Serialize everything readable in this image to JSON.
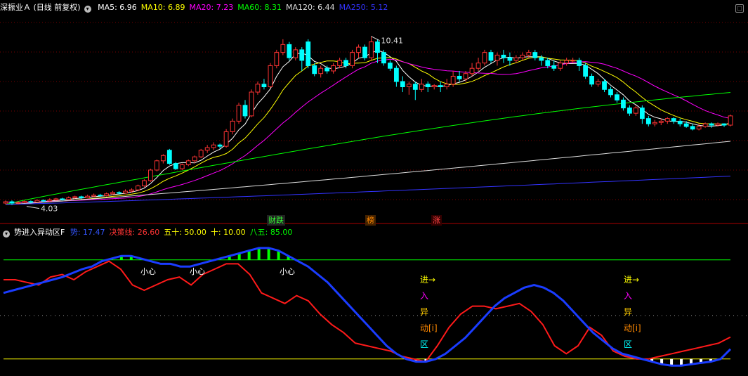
{
  "main": {
    "title": "深振业Ａ (日线 前复权)",
    "collapse_icon": "chevron-down-icon",
    "ma": [
      {
        "label": "MA5: 6.96",
        "color": "#ffffff"
      },
      {
        "label": "MA10: 6.89",
        "color": "#ffff00"
      },
      {
        "label": "MA20: 7.23",
        "color": "#ff00ff"
      },
      {
        "label": "MA60: 8.31",
        "color": "#00ff00"
      },
      {
        "label": "MA120: 6.44",
        "color": "#dddddd"
      },
      {
        "label": "MA250: 5.12",
        "color": "#3333ff"
      }
    ],
    "high_label": "10.41",
    "low_label": "4.03",
    "events": [
      {
        "label": "财跌",
        "color": "#33ff33",
        "bg": "#222222"
      },
      {
        "label": "榜",
        "color": "#ff8800",
        "bg": "#442200"
      },
      {
        "label": "涨",
        "color": "#ff4444",
        "bg": "#330000"
      }
    ],
    "up_color": "#ff3333",
    "down_color": "#00ffff",
    "expand_icon": "maximize-icon"
  },
  "indicator": {
    "title": "势进入异动区F",
    "params": [
      {
        "label": "势: 17.47",
        "color": "#3355ff"
      },
      {
        "label": "决策线: 26.60",
        "color": "#ff3333"
      },
      {
        "label": "五十: 50.00",
        "color": "#ffff00"
      },
      {
        "label": "十: 10.00",
        "color": "#ffff00"
      },
      {
        "label": "八五: 85.00",
        "color": "#00ff00"
      }
    ],
    "xiaoxin": "小心",
    "signal": {
      "jin": "进→",
      "ru": "入",
      "yi": "异",
      "dong": "动[i]",
      "qu": "区"
    },
    "line_85_color": "#00ff00",
    "line_10_color": "#ffff00",
    "bar_color_high": "#00ff00",
    "bar_color_low": "#ffffff",
    "shi_color": "#1a3cff",
    "jue_color": "#ff1a1a"
  },
  "chart_data": [
    {
      "type": "candlestick",
      "title": "深振业Ａ (日线 前复权)",
      "period": "日线",
      "adjust": "前复权",
      "series_values": {
        "MA5": 6.96,
        "MA10": 6.89,
        "MA20": 7.23,
        "MA60": 8.31,
        "MA120": 6.44,
        "MA250": 5.12
      },
      "annotations": [
        {
          "label": "10.41",
          "type": "high"
        },
        {
          "label": "4.03",
          "type": "low"
        }
      ],
      "ylim": [
        3.7,
        11.2
      ],
      "grid": true,
      "candles": [
        [
          4.1,
          4.15,
          4.05,
          4.2
        ],
        [
          4.15,
          4.1,
          4.03,
          4.2
        ],
        [
          4.1,
          4.12,
          4.05,
          4.18
        ],
        [
          4.12,
          4.16,
          4.1,
          4.2
        ],
        [
          4.16,
          4.14,
          4.1,
          4.2
        ],
        [
          4.14,
          4.2,
          4.12,
          4.25
        ],
        [
          4.2,
          4.18,
          4.12,
          4.24
        ],
        [
          4.18,
          4.22,
          4.15,
          4.28
        ],
        [
          4.22,
          4.26,
          4.2,
          4.3
        ],
        [
          4.26,
          4.24,
          4.2,
          4.3
        ],
        [
          4.24,
          4.3,
          4.22,
          4.35
        ],
        [
          4.3,
          4.34,
          4.26,
          4.38
        ],
        [
          4.34,
          4.3,
          4.25,
          4.38
        ],
        [
          4.3,
          4.36,
          4.28,
          4.42
        ],
        [
          4.36,
          4.4,
          4.32,
          4.46
        ],
        [
          4.4,
          4.38,
          4.33,
          4.45
        ],
        [
          4.38,
          4.45,
          4.35,
          4.5
        ],
        [
          4.45,
          4.5,
          4.4,
          4.56
        ],
        [
          4.5,
          4.48,
          4.42,
          4.55
        ],
        [
          4.48,
          4.55,
          4.45,
          4.62
        ],
        [
          4.55,
          4.6,
          4.5,
          4.66
        ],
        [
          4.6,
          4.75,
          4.56,
          4.8
        ],
        [
          4.75,
          4.95,
          4.7,
          5.0
        ],
        [
          4.95,
          5.35,
          4.9,
          5.4
        ],
        [
          5.35,
          5.7,
          5.3,
          5.75
        ],
        [
          5.7,
          5.9,
          5.6,
          5.95
        ],
        [
          6.1,
          5.6,
          5.55,
          6.15
        ],
        [
          5.6,
          5.4,
          5.35,
          5.65
        ],
        [
          5.4,
          5.55,
          5.35,
          5.6
        ],
        [
          5.55,
          5.7,
          5.5,
          5.75
        ],
        [
          5.7,
          5.85,
          5.6,
          5.9
        ],
        [
          5.85,
          6.1,
          5.8,
          6.15
        ],
        [
          6.1,
          6.2,
          6.0,
          6.3
        ],
        [
          6.2,
          6.3,
          6.1,
          6.4
        ],
        [
          6.3,
          6.25,
          6.15,
          6.35
        ],
        [
          6.25,
          6.8,
          6.2,
          6.9
        ],
        [
          6.8,
          7.2,
          6.7,
          7.3
        ],
        [
          7.2,
          7.8,
          7.1,
          7.9
        ],
        [
          7.8,
          7.4,
          7.3,
          8.0
        ],
        [
          7.4,
          8.3,
          7.35,
          8.4
        ],
        [
          8.3,
          8.6,
          8.2,
          8.7
        ],
        [
          8.6,
          8.5,
          8.4,
          8.8
        ],
        [
          8.5,
          9.3,
          8.45,
          9.4
        ],
        [
          9.3,
          9.8,
          9.2,
          9.9
        ],
        [
          9.8,
          10.1,
          9.7,
          10.3
        ],
        [
          10.1,
          9.6,
          9.5,
          10.2
        ],
        [
          9.6,
          9.9,
          9.5,
          10.0
        ],
        [
          9.9,
          9.5,
          9.1,
          10.0
        ],
        [
          10.2,
          9.3,
          9.2,
          10.3
        ],
        [
          9.3,
          9.0,
          8.9,
          9.4
        ],
        [
          9.0,
          9.2,
          8.85,
          9.3
        ],
        [
          9.2,
          9.1,
          9.0,
          9.3
        ],
        [
          9.1,
          9.3,
          9.0,
          9.4
        ],
        [
          9.3,
          9.5,
          9.2,
          9.6
        ],
        [
          9.5,
          9.3,
          9.2,
          9.6
        ],
        [
          9.3,
          9.8,
          9.2,
          9.9
        ],
        [
          9.8,
          10.0,
          9.6,
          10.1
        ],
        [
          10.0,
          9.6,
          9.5,
          10.1
        ],
        [
          9.6,
          10.2,
          9.5,
          10.41
        ],
        [
          10.2,
          9.8,
          9.4,
          10.3
        ],
        [
          9.8,
          9.4,
          9.3,
          9.9
        ],
        [
          9.4,
          9.2,
          9.1,
          9.5
        ],
        [
          9.2,
          8.7,
          8.5,
          9.3
        ],
        [
          8.7,
          8.5,
          8.3,
          8.9
        ],
        [
          8.5,
          8.6,
          8.2,
          8.7
        ],
        [
          8.6,
          8.4,
          8.0,
          8.7
        ],
        [
          8.4,
          8.6,
          8.3,
          8.8
        ],
        [
          8.6,
          8.5,
          8.3,
          8.7
        ],
        [
          8.5,
          8.55,
          8.4,
          8.6
        ],
        [
          8.55,
          8.5,
          8.3,
          8.7
        ],
        [
          8.5,
          8.6,
          8.4,
          8.8
        ],
        [
          8.6,
          8.9,
          8.5,
          9.1
        ],
        [
          8.9,
          8.8,
          8.7,
          9.1
        ],
        [
          8.8,
          9.0,
          8.7,
          9.1
        ],
        [
          9.0,
          9.2,
          8.9,
          9.4
        ],
        [
          9.2,
          9.4,
          9.1,
          9.6
        ],
        [
          9.4,
          9.8,
          9.3,
          9.9
        ],
        [
          9.8,
          9.5,
          9.4,
          9.9
        ],
        [
          9.5,
          9.7,
          9.3,
          9.8
        ],
        [
          9.7,
          9.6,
          9.4,
          9.9
        ],
        [
          9.6,
          9.5,
          9.3,
          9.8
        ],
        [
          9.5,
          9.6,
          9.4,
          9.7
        ],
        [
          9.6,
          9.7,
          9.5,
          9.8
        ],
        [
          9.7,
          9.8,
          9.6,
          9.9
        ],
        [
          9.8,
          9.6,
          9.5,
          9.9
        ],
        [
          9.6,
          9.5,
          9.3,
          9.7
        ],
        [
          9.5,
          9.3,
          9.2,
          9.6
        ],
        [
          9.3,
          9.2,
          9.1,
          9.5
        ],
        [
          9.2,
          9.4,
          9.1,
          9.5
        ],
        [
          9.4,
          9.5,
          9.3,
          9.6
        ],
        [
          9.5,
          9.5,
          9.4,
          9.6
        ],
        [
          9.5,
          9.3,
          9.1,
          9.6
        ],
        [
          9.3,
          8.9,
          8.8,
          9.4
        ],
        [
          8.9,
          8.6,
          8.5,
          9.0
        ],
        [
          8.6,
          8.7,
          8.5,
          8.8
        ],
        [
          8.7,
          8.4,
          8.3,
          8.8
        ],
        [
          8.4,
          8.2,
          8.1,
          8.5
        ],
        [
          8.2,
          8.0,
          7.9,
          8.3
        ],
        [
          8.0,
          7.7,
          7.6,
          8.1
        ],
        [
          7.7,
          7.5,
          7.4,
          7.8
        ],
        [
          7.5,
          7.7,
          7.4,
          7.8
        ],
        [
          7.7,
          7.3,
          7.1,
          7.8
        ],
        [
          7.3,
          7.1,
          7.0,
          7.4
        ],
        [
          7.1,
          7.15,
          7.0,
          7.25
        ],
        [
          7.15,
          7.2,
          7.05,
          7.3
        ],
        [
          7.2,
          7.3,
          7.1,
          7.35
        ],
        [
          7.3,
          7.2,
          7.1,
          7.35
        ],
        [
          7.2,
          7.1,
          7.0,
          7.3
        ],
        [
          7.1,
          7.0,
          6.95,
          7.2
        ],
        [
          7.0,
          6.9,
          6.85,
          7.1
        ],
        [
          6.9,
          7.0,
          6.85,
          7.1
        ],
        [
          7.0,
          7.1,
          6.95,
          7.15
        ],
        [
          7.1,
          7.05,
          6.95,
          7.15
        ],
        [
          7.05,
          7.1,
          7.0,
          7.15
        ],
        [
          7.1,
          7.05,
          6.98,
          7.12
        ],
        [
          7.05,
          7.4,
          7.0,
          7.45
        ]
      ]
    },
    {
      "type": "line",
      "title": "势进入异动区F",
      "ylim": [
        0,
        100
      ],
      "reference_lines": [
        {
          "name": "八五",
          "value": 85
        },
        {
          "name": "五十",
          "value": 50
        },
        {
          "name": "十",
          "value": 10
        }
      ],
      "series": [
        {
          "name": "势",
          "last": 17.47,
          "values": [
            60,
            62,
            64,
            66,
            68,
            70,
            72,
            75,
            78,
            80,
            84,
            86,
            88,
            88,
            86,
            84,
            82,
            82,
            80,
            80,
            82,
            84,
            86,
            88,
            90,
            92,
            94,
            94,
            92,
            88,
            84,
            80,
            74,
            68,
            60,
            52,
            44,
            36,
            28,
            20,
            14,
            10,
            8,
            8,
            10,
            14,
            20,
            26,
            34,
            42,
            50,
            56,
            60,
            64,
            66,
            64,
            60,
            54,
            46,
            38,
            30,
            24,
            18,
            14,
            12,
            10,
            8,
            6,
            5,
            5,
            6,
            7,
            8,
            10,
            17.47
          ]
        },
        {
          "name": "决策线",
          "last": 26.6,
          "values": [
            70,
            70,
            68,
            66,
            72,
            74,
            70,
            76,
            80,
            84,
            78,
            66,
            62,
            66,
            70,
            72,
            66,
            74,
            78,
            82,
            82,
            74,
            60,
            56,
            52,
            58,
            54,
            44,
            36,
            30,
            22,
            20,
            18,
            16,
            12,
            10,
            8,
            20,
            34,
            44,
            50,
            50,
            48,
            50,
            52,
            46,
            36,
            20,
            14,
            20,
            34,
            28,
            16,
            12,
            10,
            10,
            12,
            14,
            16,
            18,
            20,
            22,
            26.6
          ]
        }
      ]
    }
  ]
}
